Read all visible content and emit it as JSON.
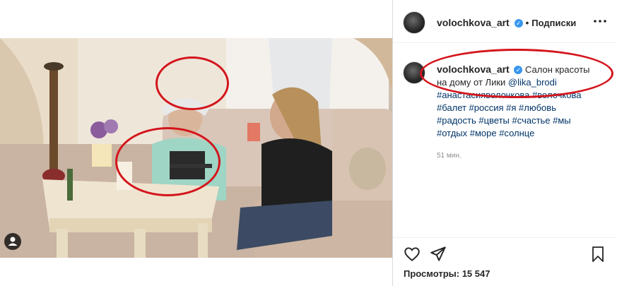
{
  "post": {
    "author": "volochkova_art",
    "follow_status": "Подписки",
    "caption_author": "volochkova_art",
    "caption_text": "Салон красоты на дому от Лики",
    "caption_mention": "@lika_brodi",
    "hashtags_line1": "#анастасияволочкова #волочкова",
    "hashtags_line2": "#балет #россия #я #любовь",
    "hashtags_line3": "#радость #цветы #счастье #мы",
    "hashtags_line4": "#отдых #море #солнце",
    "time_ago": "51 мин.",
    "views": "Просмотры: 15 547",
    "more_icon": "ellipsis-icon"
  },
  "icons": {
    "like": "heart-icon",
    "share": "paper-plane-icon",
    "save": "bookmark-icon",
    "media_user": "user-tag-icon"
  },
  "colors": {
    "annotation": "#d4151c",
    "verified": "#3897f0",
    "hashtag": "#003569"
  }
}
